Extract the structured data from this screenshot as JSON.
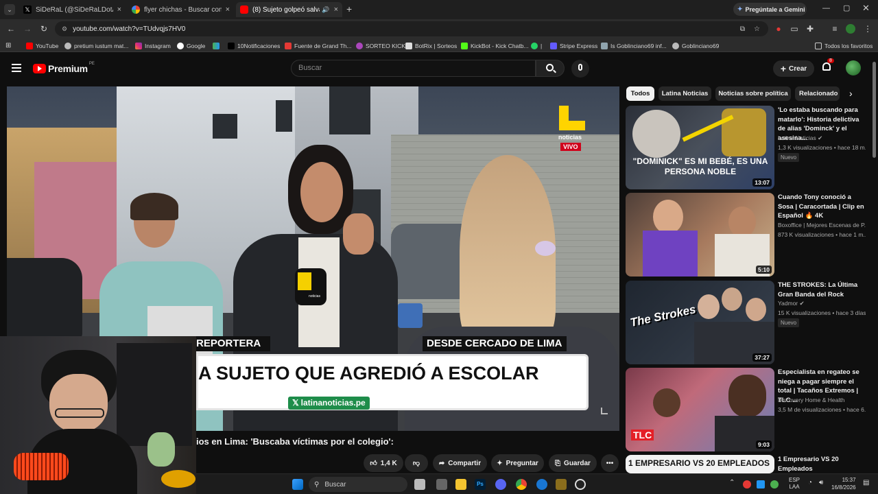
{
  "browser": {
    "tabs": [
      {
        "title": "SiDeRaL (@SiDeRaLDotA) / X",
        "active": false
      },
      {
        "title": "flyer chichas - Buscar con Goog",
        "active": false
      },
      {
        "title": "(8) Sujeto golpeó salvajem",
        "active": true
      }
    ],
    "gemini_label": "Pregúntale a Gemini",
    "url": "youtube.com/watch?v=TUdvqjs7HV0",
    "bookmarks": [
      "YouTube",
      "pretium iustum mat...",
      "Instagram",
      "Google",
      "10Notificaciones",
      "Fuente de Grand Th...",
      "SORTEO KICK",
      "BotRix | Sorteos",
      "KickBot - Kick Chatb...",
      "|",
      "Stripe Express",
      "Is Goblinciano69 inf...",
      "Goblinciano69"
    ],
    "all_bookmarks_label": "Todos los favoritos"
  },
  "youtube": {
    "logo": "Premium",
    "logo_region": "PE",
    "search_placeholder": "Buscar",
    "create_label": "Crear",
    "notif_count": "8"
  },
  "video": {
    "brand": "noticias",
    "live_label": "VIVO",
    "lower_left": "REPORTERA",
    "lower_right": "DESDE CERCADO DE LIMA",
    "headline": "A SUJETO QUE AGREDIÓ A ESCOLAR",
    "handle": "latinanoticias.pe",
    "mic_label": "noticias",
    "title": "ios en Lima: 'Buscaba víctimas por el colegio':",
    "likes": "1,4 K",
    "share_label": "Compartir",
    "ask_label": "Preguntar",
    "save_label": "Guardar"
  },
  "chips": [
    "Todos",
    "Latina Noticias",
    "Noticias sobre política",
    "Relacionado"
  ],
  "recommendations": [
    {
      "title": "'Lo estaba buscando para matarlo': Historia delictiva de alias 'Dominck' y el asesina...",
      "channel": "Latina Noticias",
      "verified": true,
      "meta": "1,3 K visualizaciones • hace 18 m...",
      "badge": "Nuevo",
      "duration": "13:07",
      "thumb_text": "\"DOMINICK\" ES MI BEBÉ, ES UNA PERSONA NOBLE"
    },
    {
      "title": "Cuando Tony conoció a Sosa | Caracortada | Clip en Español 🔥 4K",
      "channel": "Boxoffice | Mejores Escenas de P...",
      "verified": false,
      "meta": "873 K visualizaciones • hace 1 m...",
      "badge": "",
      "duration": "5:10",
      "thumb_text": ""
    },
    {
      "title": "THE STROKES: La Última Gran Banda del Rock",
      "channel": "Yadmor",
      "verified": true,
      "meta": "15 K visualizaciones • hace 3 días",
      "badge": "Nuevo",
      "duration": "37:27",
      "thumb_text": "The Strokes"
    },
    {
      "title": "Especialista en regateo se niega a pagar siempre el total | Tacaños Extremos | TLC ...",
      "channel": "Discovery Home & Health",
      "verified": false,
      "meta": "3,5 M de visualizaciones • hace 6...",
      "badge": "",
      "duration": "9:03",
      "thumb_text": "TLC"
    },
    {
      "title": "1 Empresario VS 20 Empleados",
      "channel": "",
      "verified": false,
      "meta": "",
      "badge": "",
      "duration": "",
      "thumb_text": "1 EMPRESARIO VS 20 EMPLEADOS"
    }
  ],
  "taskbar": {
    "search_placeholder": "Buscar",
    "lang_top": "ESP",
    "lang_bottom": "LAA",
    "time": "15:37",
    "date": "16/8/2026"
  }
}
